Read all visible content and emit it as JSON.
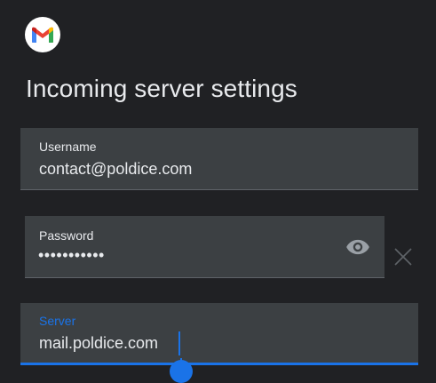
{
  "app": {
    "icon": "gmail-icon"
  },
  "header": {
    "title": "Incoming server settings"
  },
  "form": {
    "username": {
      "label": "Username",
      "value": "contact@poldice.com"
    },
    "password": {
      "label": "Password",
      "value": "•••••••••••",
      "toggle_icon": "eye-icon",
      "clear_icon": "close-icon"
    },
    "server": {
      "label": "Server",
      "value": "mail.poldice.com",
      "focused": true
    }
  },
  "colors": {
    "background": "#202124",
    "field_fill": "#3c4043",
    "text": "#e8eaed",
    "accent": "#1a73e8",
    "icon_gray": "#9aa0a6"
  }
}
